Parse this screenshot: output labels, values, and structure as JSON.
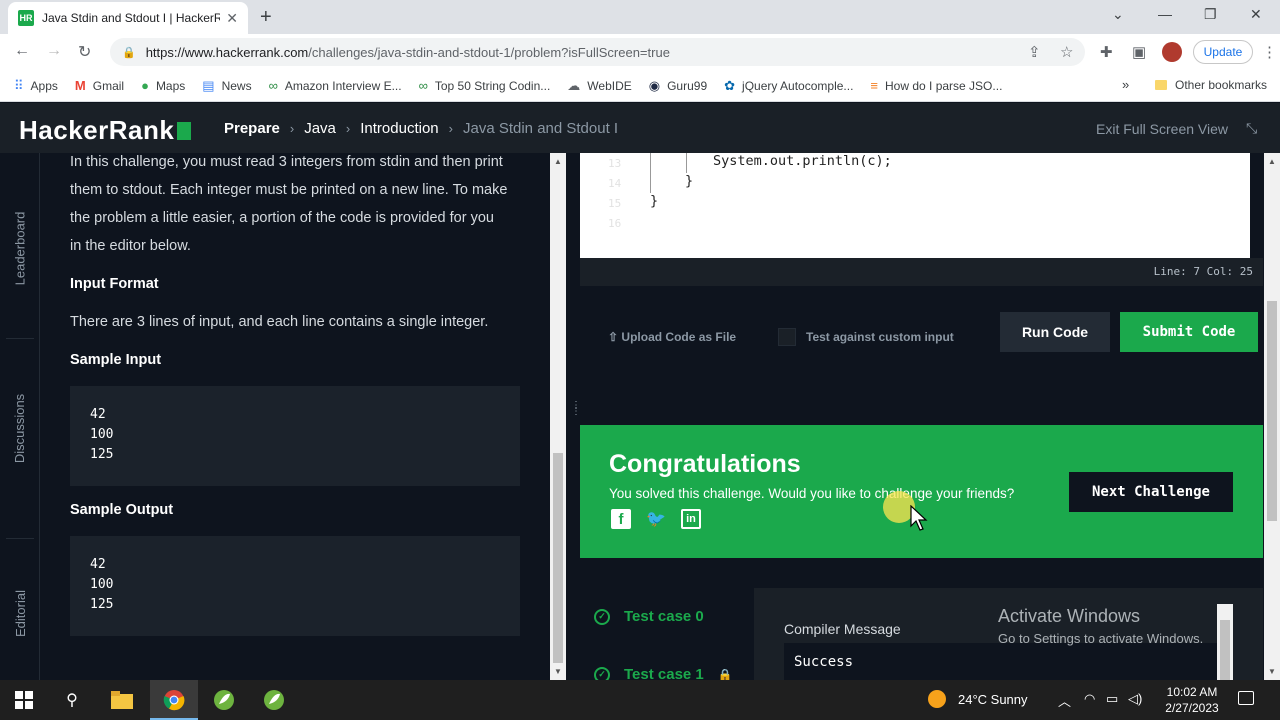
{
  "browser": {
    "tab_title": "Java Stdin and Stdout I | HackerR",
    "tab_favicon": "HR",
    "url_host": "https://www.hackerrank.com",
    "url_path": "/challenges/java-stdin-and-stdout-1/problem?isFullScreen=true",
    "update_label": "Update",
    "bookmarks": [
      {
        "label": "Apps",
        "icon": "apps-grid-icon"
      },
      {
        "label": "Gmail",
        "icon": "gmail-icon"
      },
      {
        "label": "Maps",
        "icon": "maps-pin-icon"
      },
      {
        "label": "News",
        "icon": "news-icon"
      },
      {
        "label": "Amazon Interview E...",
        "icon": "geeks-icon"
      },
      {
        "label": "Top 50 String Codin...",
        "icon": "geeks-icon"
      },
      {
        "label": "WebIDE",
        "icon": "cloud-icon"
      },
      {
        "label": "Guru99",
        "icon": "guru-icon"
      },
      {
        "label": "jQuery Autocomple...",
        "icon": "jquery-icon"
      },
      {
        "label": "How do I parse JSO...",
        "icon": "stackoverflow-icon"
      }
    ],
    "bookmarks_more": "»",
    "other_bookmarks": "Other bookmarks"
  },
  "header": {
    "logo": "HackerRank",
    "breadcrumbs": [
      "Prepare",
      "Java",
      "Introduction",
      "Java Stdin and Stdout I"
    ],
    "exit_fullscreen": "Exit Full Screen View"
  },
  "sidebar": {
    "tabs": [
      "Leaderboard",
      "Discussions",
      "Editorial"
    ]
  },
  "problem": {
    "intro_lines": [
      "In this challenge, you must read 3 integers from stdin and then print",
      "them to stdout. Each integer must be printed on a new line. To make",
      "the problem a little easier, a portion of the code is provided for you",
      "in the editor below."
    ],
    "input_format_title": "Input Format",
    "input_format_text": "There are 3 lines of input, and each line contains a single integer.",
    "sample_input_title": "Sample Input",
    "sample_input": [
      "42",
      "100",
      "125"
    ],
    "sample_output_title": "Sample Output",
    "sample_output": [
      "42",
      "100",
      "125"
    ]
  },
  "editor": {
    "lines": [
      {
        "num": "13",
        "code": "System.out.println(c);"
      },
      {
        "num": "14",
        "code": "}"
      },
      {
        "num": "15",
        "code": "}"
      },
      {
        "num": "16",
        "code": ""
      }
    ],
    "status": "Line: 7 Col: 25"
  },
  "actions": {
    "upload_label": "Upload Code as File",
    "custom_input_label": "Test against custom input",
    "run_label": "Run Code",
    "submit_label": "Submit Code"
  },
  "congrats": {
    "title": "Congratulations",
    "subtitle": "You solved this challenge. Would you like to challenge your friends?",
    "next_label": "Next Challenge",
    "social": [
      "facebook-icon",
      "twitter-icon",
      "linkedin-icon"
    ]
  },
  "results": {
    "test_cases": [
      {
        "label": "Test case 0",
        "locked": false
      },
      {
        "label": "Test case 1",
        "locked": true
      }
    ],
    "compiler_label": "Compiler Message",
    "compiler_value": "Success"
  },
  "watermark": {
    "line1": "Activate Windows",
    "line2": "Go to Settings to activate Windows."
  },
  "taskbar": {
    "weather": "24°C  Sunny",
    "time": "10:02 AM",
    "date": "2/27/2023"
  },
  "colors": {
    "accent_green": "#1ba94c",
    "header_bg": "#1a2027",
    "page_bg": "#0e141e"
  }
}
